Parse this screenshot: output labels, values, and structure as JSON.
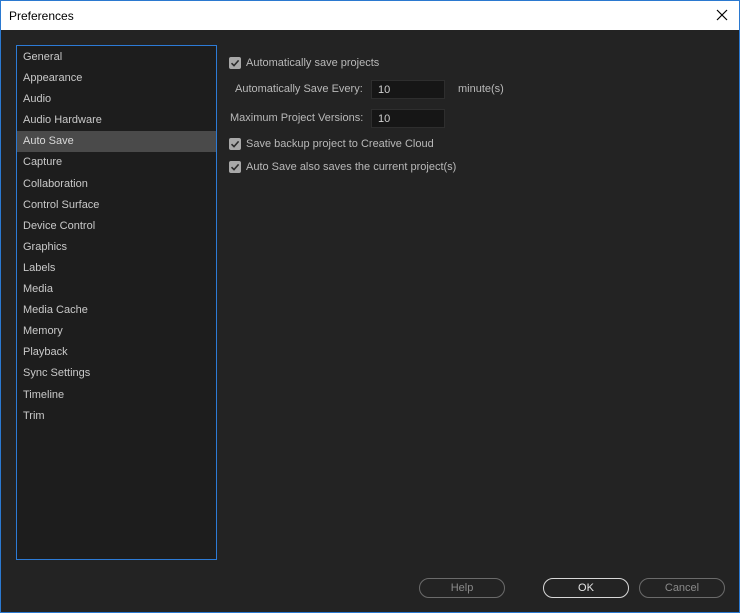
{
  "window": {
    "title": "Preferences"
  },
  "sidebar": {
    "selected_index": 4,
    "items": [
      {
        "label": "General"
      },
      {
        "label": "Appearance"
      },
      {
        "label": "Audio"
      },
      {
        "label": "Audio Hardware"
      },
      {
        "label": "Auto Save"
      },
      {
        "label": "Capture"
      },
      {
        "label": "Collaboration"
      },
      {
        "label": "Control Surface"
      },
      {
        "label": "Device Control"
      },
      {
        "label": "Graphics"
      },
      {
        "label": "Labels"
      },
      {
        "label": "Media"
      },
      {
        "label": "Media Cache"
      },
      {
        "label": "Memory"
      },
      {
        "label": "Playback"
      },
      {
        "label": "Sync Settings"
      },
      {
        "label": "Timeline"
      },
      {
        "label": "Trim"
      }
    ]
  },
  "autosave": {
    "auto_save_projects": {
      "label": "Automatically save projects",
      "checked": true
    },
    "save_every": {
      "label": "Automatically Save Every:",
      "value": "10",
      "unit": "minute(s)"
    },
    "max_versions": {
      "label": "Maximum Project Versions:",
      "value": "10"
    },
    "backup_cloud": {
      "label": "Save backup project to Creative Cloud",
      "checked": true
    },
    "saves_current": {
      "label": "Auto Save also saves the current project(s)",
      "checked": true
    }
  },
  "buttons": {
    "help": "Help",
    "ok": "OK",
    "cancel": "Cancel"
  }
}
